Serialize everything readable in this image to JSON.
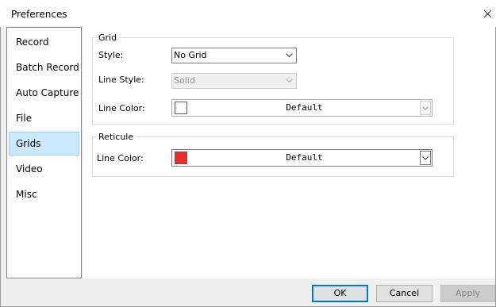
{
  "window": {
    "title": "Preferences"
  },
  "nav": {
    "items": [
      {
        "label": "Record"
      },
      {
        "label": "Batch Record"
      },
      {
        "label": "Auto Capture"
      },
      {
        "label": "File"
      },
      {
        "label": "Grids",
        "selected": true
      },
      {
        "label": "Video"
      },
      {
        "label": "Misc"
      }
    ]
  },
  "grid_group": {
    "legend": "Grid",
    "style_label": "Style:",
    "style_value": "No Grid",
    "line_style_label": "Line Style:",
    "line_style_value": "Solid",
    "line_color_label": "Line Color:",
    "line_color_value": "Default",
    "line_color_swatch": "#ffffff"
  },
  "reticule_group": {
    "legend": "Reticule",
    "line_color_label": "Line Color:",
    "line_color_value": "Default",
    "line_color_swatch": "#ee2b2b"
  },
  "buttons": {
    "ok": "OK",
    "cancel": "Cancel",
    "apply": "Apply"
  },
  "colors": {
    "selection_bg": "#cce8ff",
    "focus_border": "#0078d7",
    "dialog_bg": "#f0f0f0"
  }
}
